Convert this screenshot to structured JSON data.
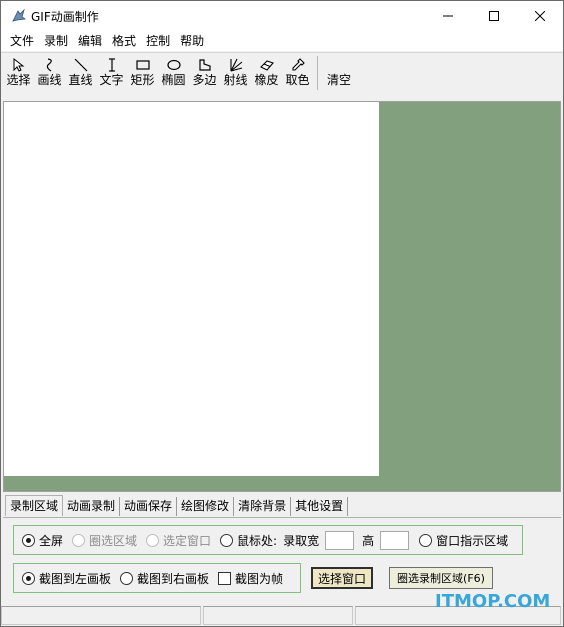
{
  "window": {
    "title": "GIF动画制作"
  },
  "menu": [
    "文件",
    "录制",
    "编辑",
    "格式",
    "控制",
    "帮助"
  ],
  "toolbar": {
    "tools": [
      {
        "label": "选择",
        "icon": "cursor-arrow-icon"
      },
      {
        "label": "画线",
        "icon": "freehand-line-icon"
      },
      {
        "label": "直线",
        "icon": "straight-line-icon"
      },
      {
        "label": "文字",
        "icon": "text-cursor-icon"
      },
      {
        "label": "矩形",
        "icon": "rectangle-icon"
      },
      {
        "label": "椭圆",
        "icon": "ellipse-icon"
      },
      {
        "label": "多边",
        "icon": "polygon-icon"
      },
      {
        "label": "射线",
        "icon": "ray-icon"
      },
      {
        "label": "橡皮",
        "icon": "eraser-icon"
      },
      {
        "label": "取色",
        "icon": "eyedropper-icon"
      }
    ],
    "clear_label": "清空"
  },
  "tabs": [
    "录制区域",
    "动画录制",
    "动画保存",
    "绘图修改",
    "清除背景",
    "其他设置"
  ],
  "region_options": {
    "fullscreen": "全屏",
    "circle_select": "圈选区域",
    "select_window": "选定窗口",
    "at_mouse": "鼠标处:",
    "record_width": "录取宽",
    "height": "高",
    "window_indicator": "窗口指示区域"
  },
  "capture_options": {
    "to_left": "截图到左画板",
    "to_right": "截图到右画板",
    "as_frame": "截图为帧"
  },
  "buttons": {
    "select_window": "选择窗口",
    "select_region": "圈选录制区域(F6)"
  },
  "watermark": "ITMOP.COM",
  "colors": {
    "workspace_bg": "#82a07e",
    "group_border": "#7fbf7f",
    "watermark": "#39a6d9"
  }
}
